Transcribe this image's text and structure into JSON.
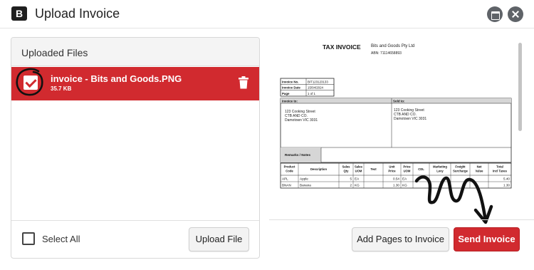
{
  "dialog": {
    "logo_letter": "B",
    "title": "Upload Invoice"
  },
  "files_panel": {
    "heading": "Uploaded Files",
    "files": [
      {
        "name": "invoice - Bits and Goods.PNG",
        "size": "35.7 KB",
        "selected": true
      }
    ],
    "select_all_label": "Select All",
    "upload_button": "Upload File"
  },
  "preview": {
    "doc_title": "TAX INVOICE",
    "company": "Bits and Goods Pty Ltd",
    "abn": "ABN: 71114658893",
    "meta": [
      {
        "label": "Invoice No.",
        "value": "BIT123123133"
      },
      {
        "label": "Invoice Date",
        "value": "15/04/2024"
      },
      {
        "label": "Page",
        "value": "1 of 1"
      }
    ],
    "invoice_to_label": "Invoice to:",
    "sold_to_label": "Sold to:",
    "invoice_to": [
      "123 Cooking Street",
      "CTB AND CO.",
      "Damotown VIC 3031"
    ],
    "sold_to": [
      "123 Cooking Street",
      "CTB AND CO.",
      "Damotown VIC 3031"
    ],
    "remarks_label": "Remarks / Notes",
    "columns": [
      "Product Code",
      "Description",
      "Sales Qty",
      "Sales UOM",
      "Text",
      "Unit Price",
      "Price UOM",
      "CDL",
      "Marketing Levy",
      "Freight Surcharge",
      "Net Value",
      "Total Incl Taxes"
    ],
    "rows": [
      [
        "APL",
        "Apple",
        "5",
        "EA",
        "",
        "0.54",
        "EA",
        "",
        "",
        "",
        "",
        "5.40"
      ],
      [
        "BNAN",
        "Banana",
        "2",
        "KG",
        "",
        "1.30",
        "KG",
        "",
        "",
        "",
        "",
        "1.30"
      ]
    ]
  },
  "footer": {
    "add_pages_button": "Add Pages to Invoice",
    "send_button": "Send Invoice"
  },
  "colors": {
    "accent": "#d12a2f",
    "header_icons": "#5f6368"
  },
  "icons": {
    "minimize": "window-minimize-icon",
    "close": "close-icon",
    "trash": "trash-icon",
    "checkbox": "checkbox-icon"
  }
}
